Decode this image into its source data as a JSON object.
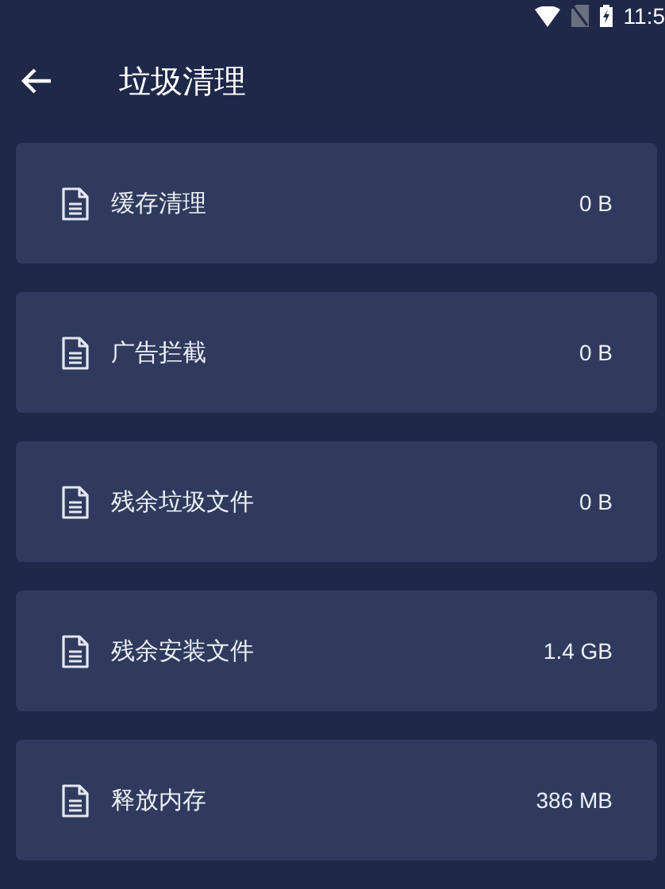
{
  "status_bar": {
    "time": "11:5"
  },
  "header": {
    "title": "垃圾清理"
  },
  "items": [
    {
      "label": "缓存清理",
      "size": "0 B"
    },
    {
      "label": "广告拦截",
      "size": "0 B"
    },
    {
      "label": "残余垃圾文件",
      "size": "0 B"
    },
    {
      "label": "残余安装文件",
      "size": "1.4 GB"
    },
    {
      "label": "释放内存",
      "size": "386 MB"
    }
  ]
}
